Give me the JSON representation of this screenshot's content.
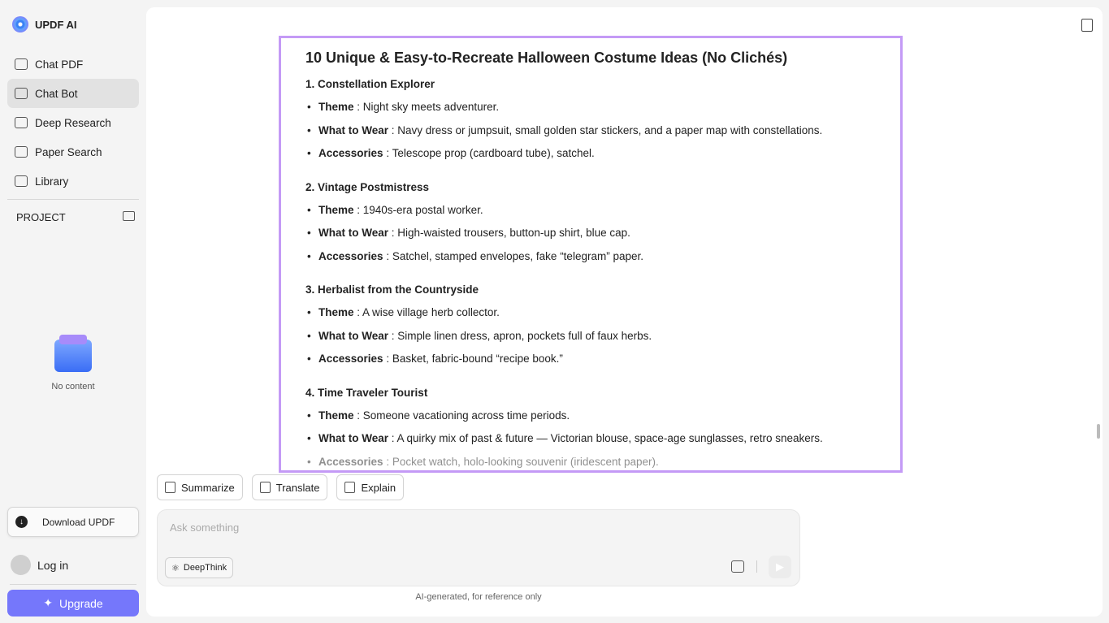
{
  "app": {
    "title": "UPDF AI"
  },
  "sidebar": {
    "items": [
      {
        "label": "Chat PDF",
        "icon": "book-icon"
      },
      {
        "label": "Chat Bot",
        "icon": "bot-icon",
        "active": true
      },
      {
        "label": "Deep Research",
        "icon": "telescope-icon"
      },
      {
        "label": "Paper Search",
        "icon": "paper-search-icon"
      },
      {
        "label": "Library",
        "icon": "library-icon"
      }
    ],
    "project_label": "PROJECT",
    "empty_text": "No content",
    "download_label": "Download UPDF",
    "login_label": "Log in",
    "upgrade_label": "Upgrade"
  },
  "answer": {
    "title": "10 Unique & Easy-to-Recreate Halloween Costume Ideas (No Clichés)",
    "sections": [
      {
        "title": "1. Constellation Explorer",
        "items": [
          {
            "k": "Theme",
            "v": " : Night sky meets adventurer."
          },
          {
            "k": "What to Wear",
            "v": " : Navy dress or jumpsuit, small golden star stickers, and a paper map with constellations."
          },
          {
            "k": "Accessories",
            "v": " : Telescope prop (cardboard tube), satchel."
          }
        ]
      },
      {
        "title": "2. Vintage Postmistress",
        "items": [
          {
            "k": "Theme",
            "v": " : 1940s-era postal worker."
          },
          {
            "k": "What to Wear",
            "v": " : High-waisted trousers, button-up shirt, blue cap."
          },
          {
            "k": "Accessories",
            "v": " : Satchel, stamped envelopes, fake “telegram” paper."
          }
        ]
      },
      {
        "title": "3. Herbalist from the Countryside",
        "items": [
          {
            "k": "Theme",
            "v": " : A wise village herb collector."
          },
          {
            "k": "What to Wear",
            "v": " : Simple linen dress, apron, pockets full of faux herbs."
          },
          {
            "k": "Accessories",
            "v": " : Basket, fabric-bound “recipe book.”"
          }
        ]
      },
      {
        "title": "4. Time Traveler Tourist",
        "items": [
          {
            "k": "Theme",
            "v": " : Someone vacationing across time periods."
          },
          {
            "k": "What to Wear",
            "v": " : A quirky mix of past & future — Victorian blouse, space-age sunglasses, retro sneakers."
          },
          {
            "k": "Accessories",
            "v": " : Pocket watch, holo-looking souvenir (iridescent paper)."
          }
        ]
      }
    ]
  },
  "actions": [
    {
      "label": "Summarize",
      "icon": "summarize-icon"
    },
    {
      "label": "Translate",
      "icon": "translate-icon"
    },
    {
      "label": "Explain",
      "icon": "book-icon"
    }
  ],
  "input": {
    "placeholder": "Ask something",
    "deepthink_label": "DeepThink"
  },
  "footer_note": "AI-generated, for reference only",
  "colors": {
    "accent": "#7577fb",
    "highlight_border": "#c49af6"
  }
}
